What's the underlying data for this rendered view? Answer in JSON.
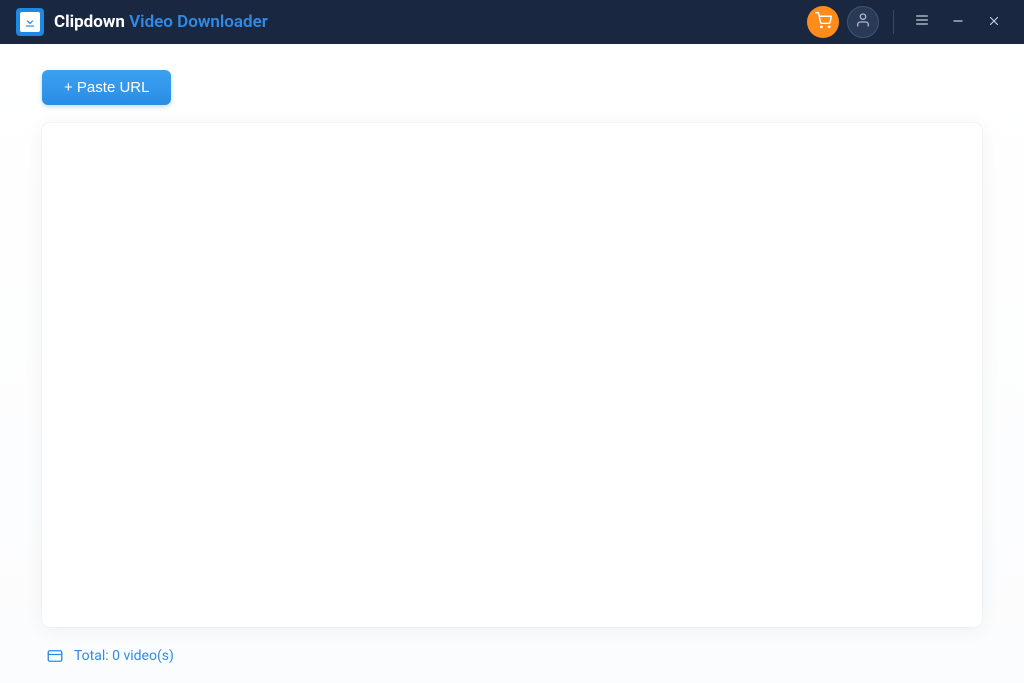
{
  "header": {
    "title_main": "Clipdown",
    "title_accent": "Video Downloader"
  },
  "toolbar": {
    "paste_url_label": "+ Paste URL"
  },
  "footer": {
    "total_label": "Total: 0 video(s)"
  },
  "colors": {
    "titlebar_bg": "#1a2741",
    "accent": "#2e8be8",
    "cart_bg": "#ff8c1a",
    "button_gradient_top": "#3ca1f0",
    "button_gradient_bottom": "#2a8de6"
  }
}
